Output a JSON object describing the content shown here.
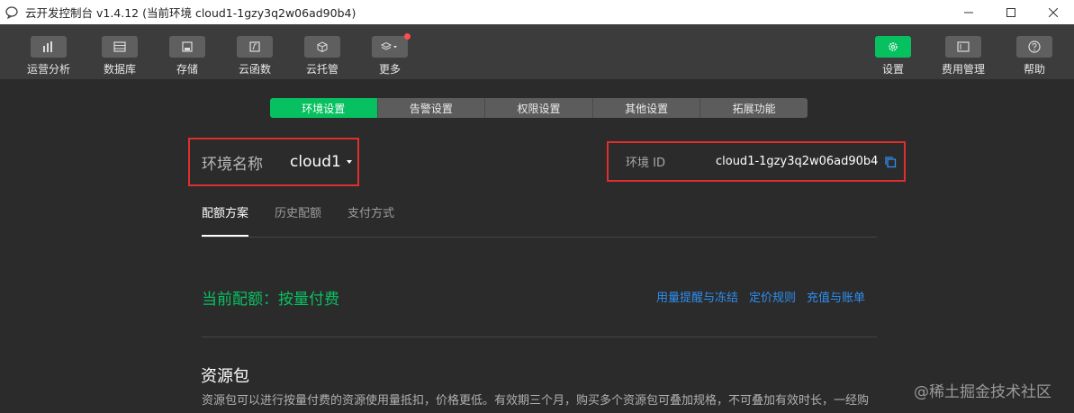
{
  "window": {
    "title": "云开发控制台 v1.4.12 (当前环境 cloud1-1gzy3q2w06ad90b4)"
  },
  "toolbar": {
    "left": [
      {
        "label": "运营分析",
        "icon": "bar-chart-icon"
      },
      {
        "label": "数据库",
        "icon": "database-icon"
      },
      {
        "label": "存储",
        "icon": "storage-icon"
      },
      {
        "label": "云函数",
        "icon": "cloud-function-icon"
      },
      {
        "label": "云托管",
        "icon": "cube-icon"
      },
      {
        "label": "更多",
        "icon": "layers-icon"
      }
    ],
    "right": [
      {
        "label": "设置",
        "icon": "gear-icon"
      },
      {
        "label": "费用管理",
        "icon": "billing-icon"
      },
      {
        "label": "帮助",
        "icon": "help-icon"
      }
    ]
  },
  "tabs": [
    "环境设置",
    "告警设置",
    "权限设置",
    "其他设置",
    "拓展功能"
  ],
  "env": {
    "name_label": "环境名称",
    "name_value": "cloud1",
    "id_label": "环境 ID",
    "id_value": "cloud1-1gzy3q2w06ad90b4"
  },
  "subtabs": [
    "配额方案",
    "历史配额",
    "支付方式"
  ],
  "quota": {
    "current": "当前配额：按量付费",
    "links": [
      "用量提醒与冻结",
      "定价规则",
      "充值与账单"
    ]
  },
  "package": {
    "title": "资源包",
    "desc": "资源包可以进行按量付费的资源使用量抵扣，价格更低。有效期三个月，购买多个资源包可叠加规格，不可叠加有效时长，一经购"
  },
  "watermark": "@稀土掘金技术社区",
  "colors": {
    "accent": "#07c160",
    "link": "#2e8ff0",
    "highlight_border": "#e02e2e",
    "background": "#2b2b2b",
    "toolbar": "#3c3c3c"
  }
}
